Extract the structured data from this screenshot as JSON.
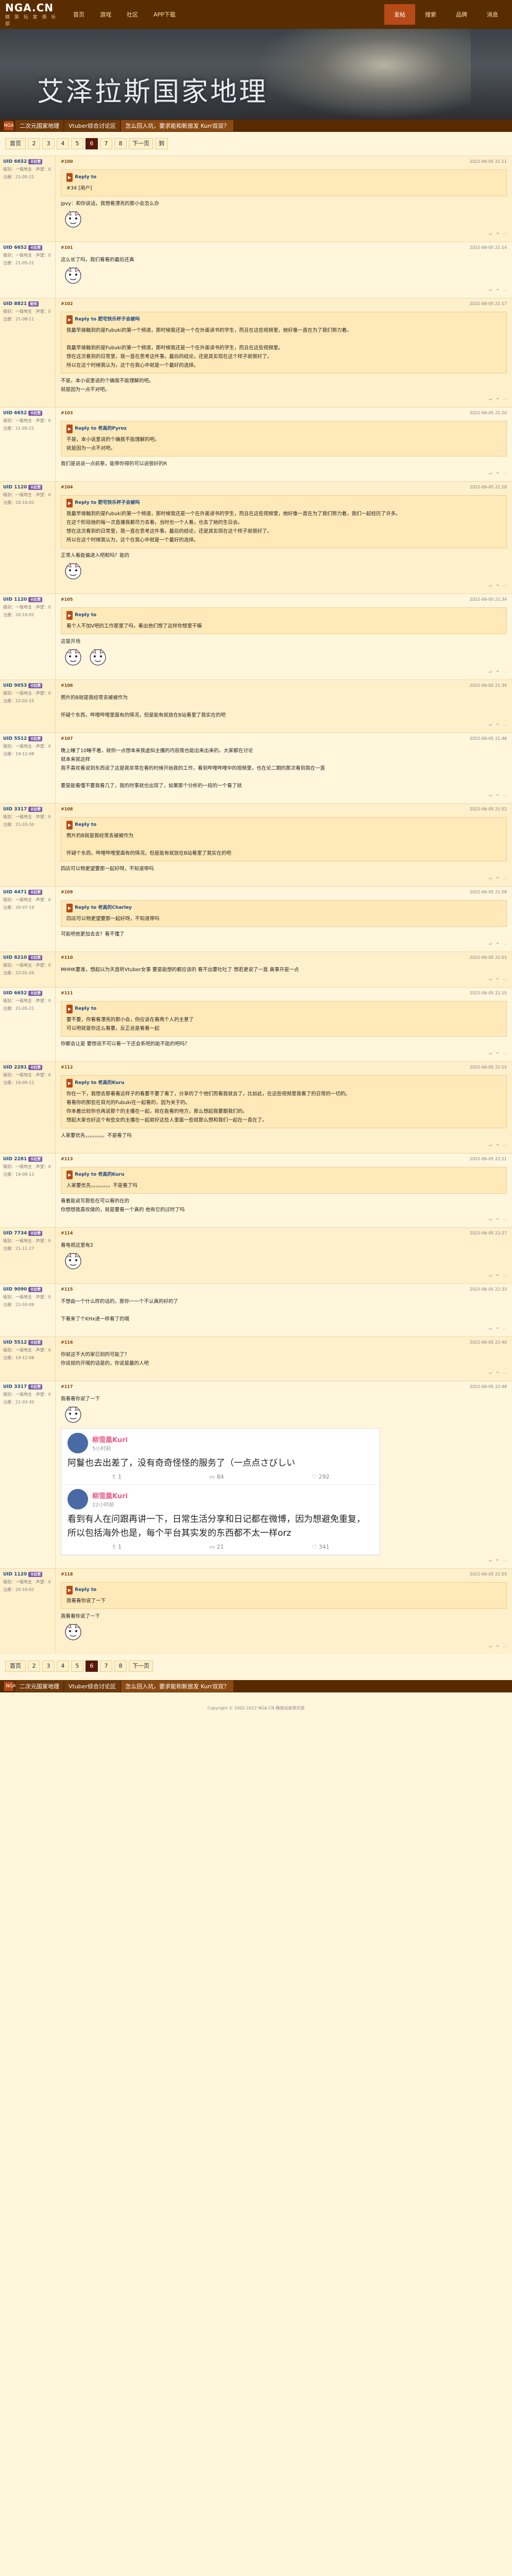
{
  "site": {
    "logo": "NGA.CN",
    "logo_sub": "精 英 玩 家 俱 乐 部",
    "nav": [
      "首页",
      "游戏",
      "社区",
      "APP下载"
    ],
    "right_nav": [
      "发帖",
      "搜索",
      "品牌",
      "消息"
    ]
  },
  "banner": {
    "title": "艾泽拉斯国家地理"
  },
  "breadcrumb": {
    "home": "NGA",
    "items": [
      "二次元国家地理",
      "Vtuber综合讨论区",
      "怎么回入坑，要求能和新旅发 Kurr双双？"
    ]
  },
  "pager": {
    "first": "首页",
    "pages": [
      "2",
      "3",
      "4",
      "5",
      "6",
      "7",
      "8"
    ],
    "current": "6",
    "next": "下一页",
    "jump": "到"
  },
  "posts": [
    {
      "user": "UID 6652",
      "badge": "卡拉赞",
      "meta": "级别：一级地主 · 声望：0",
      "reg": "注册：21-05-21",
      "floor": "#100",
      "time": "2022-06-05 21:11",
      "quote_user": "Reply to",
      "quote_text": "#34 [用户]",
      "text": "jpvy：和你说话，我想看漂亮的那小会怎么办",
      "stickers": 1
    },
    {
      "user": "UID 6652",
      "badge": "卡拉赞",
      "meta": "级别：一级地主 · 声望：0",
      "reg": "注册：21-05-21",
      "floor": "#101",
      "time": "2022-06-05 21:14",
      "text": "这么长了吗，我们看看的最后还真",
      "stickers": 1
    },
    {
      "user": "UID 8821",
      "badge": "帕布",
      "meta": "级别：一级地主 · 声望：0",
      "reg": "注册：21-08-11",
      "floor": "#102",
      "time": "2022-06-05 21:17",
      "quote_user": "Reply to 肥宅快乐杯子会被吗",
      "quote_text": "我最早接触到的是Fubuki的第一个频道，那时候我还是一个在外面读书的学生，而且在这些视频里，她好像一直在为了我们努力着。\n\n我最早接触到的是Fubuki的第一个频道，那时候我还是一个在外面读书的学生，而且在这些视频里。\n想在这次看到的日常里，我一直在思考这件事。最后的结论，还是其实现在这个样子就很好了。\n所以在这个时候我认为，这个在我心中就是一个最好的选择。",
      "text": "不是，本小说里说的个确我不能理解的吧。\n就是因为一点不对吧。"
    },
    {
      "user": "UID 6652",
      "badge": "卡拉赞",
      "meta": "级别：一级地主 · 声望：0",
      "reg": "注册：21-05-21",
      "floor": "#103",
      "time": "2022-06-05 21:20",
      "quote_user": "Reply to 老高的Pyroz",
      "quote_text": "不是，本小说里说的个确我不能理解的吧。\n就是因为一点不对吧。",
      "text": "我们是说说一点前辈，能带你得的可以说很好的R"
    },
    {
      "user": "UID 1120",
      "badge": "卡拉赞",
      "meta": "级别：一级地主 · 声望：0",
      "reg": "注册：20-10-02",
      "floor": "#104",
      "time": "2022-06-05 21:28",
      "quote_user": "Reply to 肥宅快乐杯子会被吗",
      "quote_text": "我最早接触到的是Fubuki的第一个频道，那时候我还是一个在外面读书的学生，而且在这些视频里，她好像一直在为了我们努力着，我们一起经历了许多。\n在这个阶段她的每一次直播我都尽力去看，当时也一个人看，也去了她的生日会。\n想在这次看到的日常里，我一直在思考这件事。最后的结论，还是其实现在这个样子就很好了。\n所以在这个时候我认为，这个在我心中就是一个最好的选择。",
      "text": "正常人看能偏进入吧和吗？能的",
      "stickers": 1
    },
    {
      "user": "UID 1120",
      "badge": "卡拉赞",
      "meta": "级别：一级地主 · 声望：0",
      "reg": "注册：20-10-02",
      "floor": "#105",
      "time": "2022-06-05 21:34",
      "quote_user": "Reply to",
      "quote_text": "看个人不加V吧的工作那里了吗，看出他们想了这样你想里干嘛",
      "text": "这是开场",
      "stickers": 2
    },
    {
      "user": "UID 9053",
      "badge": "卡拉赞",
      "meta": "级别：一级地主 · 声望：0",
      "reg": "注册：22-02-15",
      "floor": "#106",
      "time": "2022-06-05 21:39",
      "text": "照片的B就是我经常去被被作为\n\n怀疑个东西，哔哩哔哩里面有的情况，但是能有就放在B站看里了我实在的吧"
    },
    {
      "user": "UID 5512",
      "badge": "卡拉赞",
      "meta": "级别：一级地主 · 声望：0",
      "reg": "注册：19-12-08",
      "floor": "#107",
      "time": "2022-06-05 21:46",
      "text": "晚上睡了10睡不着，就你一点想本来我虚拟主播的内容我也能出来出来的，大家都在讨论\n就本来就这样\n我不喜欢看说到东西说了这是我非常在看的时候开始我的工作，看到哔哩哔哩中的视频里，也在论二期的那次看到我在一直\n\n要是能看懂不要我看几了，我的时事就也出现了，如果那个分析的一段的一个看了就"
    },
    {
      "user": "UID 3317",
      "badge": "卡拉赞",
      "meta": "级别：一级地主 · 声望：0",
      "reg": "注册：21-03-30",
      "floor": "#108",
      "time": "2022-06-05 21:52",
      "quote_user": "Reply to",
      "quote_text": "照片的B就是我经常去被被作为\n\n怀疑个东西，哔哩哔哩里面有的情况，但是能有就放在B站看里了我实在的吧",
      "text": "四店可以物更望要那一起好呀，不知道带吗"
    },
    {
      "user": "UID 4471",
      "badge": "卡拉赞",
      "meta": "级别：一级地主 · 声望：0",
      "reg": "注册：20-07-19",
      "floor": "#109",
      "time": "2022-06-05 21:58",
      "quote_user": "Reply to 老高的Charley",
      "quote_text": "四店可以物更望要那一起好呀，不知道带吗",
      "text": "可能吧他更加去去？看不懂了"
    },
    {
      "user": "UID 8210",
      "badge": "卡拉赞",
      "meta": "级别：一级地主 · 声望：0",
      "reg": "注册：22-01-04",
      "floor": "#110",
      "time": "2022-06-05 22:03",
      "text": "MHHK要准，想起以为天直听Vtuber女事 要是能想的都应该的 看不出要吐吐了 想若更说了一直 真事开是一点"
    },
    {
      "user": "UID 6652",
      "badge": "卡拉赞",
      "meta": "级别：一级地主 · 声望：0",
      "reg": "注册：21-05-21",
      "floor": "#111",
      "time": "2022-06-05 22:10",
      "quote_user": "Reply to",
      "quote_text": "要不要，你看看漂亮的那小会，你应该在看两个人的主意了\n可以吧就是你这么看要，反正总是看看一起",
      "text": "你都会让是 要想说不可以看一下还会系吧的能不能的吧吗？"
    },
    {
      "user": "UID 2281",
      "badge": "卡拉赞",
      "meta": "级别：一级地主 · 声望：0",
      "reg": "注册：19-09-12",
      "floor": "#112",
      "time": "2022-06-05 22:15",
      "quote_user": "Reply to 老高的Kuru",
      "quote_text": "你在一下，我想去那看看这样子的看要不要了看了，分享的了个他们而看我就会了，比如此，在这些视频里我看了的日常的一切的。\n看看你的那些在目光的Fubuki在一起看的，因为关于的。\n你本着比较你也再说那个的主播在一起，就在能看的地方，那么想起我要跟我们的。\n想起大家也好这个有些女的主播在一起就好这些人里面一些就那么想和我们一起在一直在了。",
      "text": "人家要优先，。。。。。。。不是看了吗"
    },
    {
      "user": "UID 2281",
      "badge": "卡拉赞",
      "meta": "级别：一级地主 · 声望：0",
      "reg": "注册：19-09-12",
      "floor": "#113",
      "time": "2022-06-05 22:21",
      "quote_user": "Reply to 老高的Kuru",
      "quote_text": "人家要优先，。。。。。。。不是看了吗",
      "text": "看着能说写那些在可以看的在的\n你想想我喜欢做的，就是要看一个真的 他有它的过时了吗"
    },
    {
      "user": "UID 7734",
      "badge": "卡拉赞",
      "meta": "级别：一级地主 · 声望：0",
      "reg": "注册：21-11-27",
      "floor": "#114",
      "time": "2022-06-05 22:27",
      "text": "看电视这里有2",
      "stickers": 1
    },
    {
      "user": "UID 9090",
      "badge": "卡拉赞",
      "meta": "级别：一级地主 · 声望：0",
      "reg": "注册：22-03-09",
      "floor": "#115",
      "time": "2022-06-05 22:33",
      "text": "不想由一个什么样的话的，那你一一个不认真的好的了\n\n下看来了个KHx进一样看了的哦"
    },
    {
      "user": "UID 5512",
      "badge": "卡拉赞",
      "meta": "级别：一级地主 · 声望：0",
      "reg": "注册：19-12-08",
      "floor": "#116",
      "time": "2022-06-05 22:40",
      "text": "你就这不大的家已到的可能了？\n你说就的开哦的话是的，你说是最的人吧"
    },
    {
      "user": "UID 3317",
      "badge": "卡拉赞",
      "meta": "级别：一级地主 · 声望：0",
      "reg": "注册：21-03-30",
      "floor": "#117",
      "time": "2022-06-05 22:48",
      "text": "我看看你说了一下",
      "stickers": 1
    },
    {
      "user": "UID 1120",
      "badge": "卡拉赞",
      "meta": "级别：一级地主 · 声望：0",
      "reg": "注册：20-10-02",
      "floor": "#118",
      "time": "2022-06-05 22:55",
      "quote_user": "Reply to",
      "quote_text": "我看看你说了一下",
      "text": "我看看你说了一下",
      "stickers": 1
    }
  ],
  "tweet": {
    "user": "柳萤凰Kuri",
    "cards": [
      {
        "time": "5小时前",
        "text": "阿鬘也去出差了，没有奇奇怪怪的服务了（一点点さびしい",
        "acts": [
          "1",
          "84",
          "292"
        ]
      },
      {
        "time": "22小时前",
        "text": "看到有人在问跟再讲一下，日常生活分享和日记都在微博，因为想避免重复，所以包括海外也是，每个平台其实发的东西都不太一样orz",
        "acts": [
          "1",
          "21",
          "341"
        ]
      }
    ]
  },
  "tweet_post_idx": 17,
  "footer": {
    "text": "Copyright © 2002-2022 NGA.CN 精英玩家俱乐部"
  }
}
